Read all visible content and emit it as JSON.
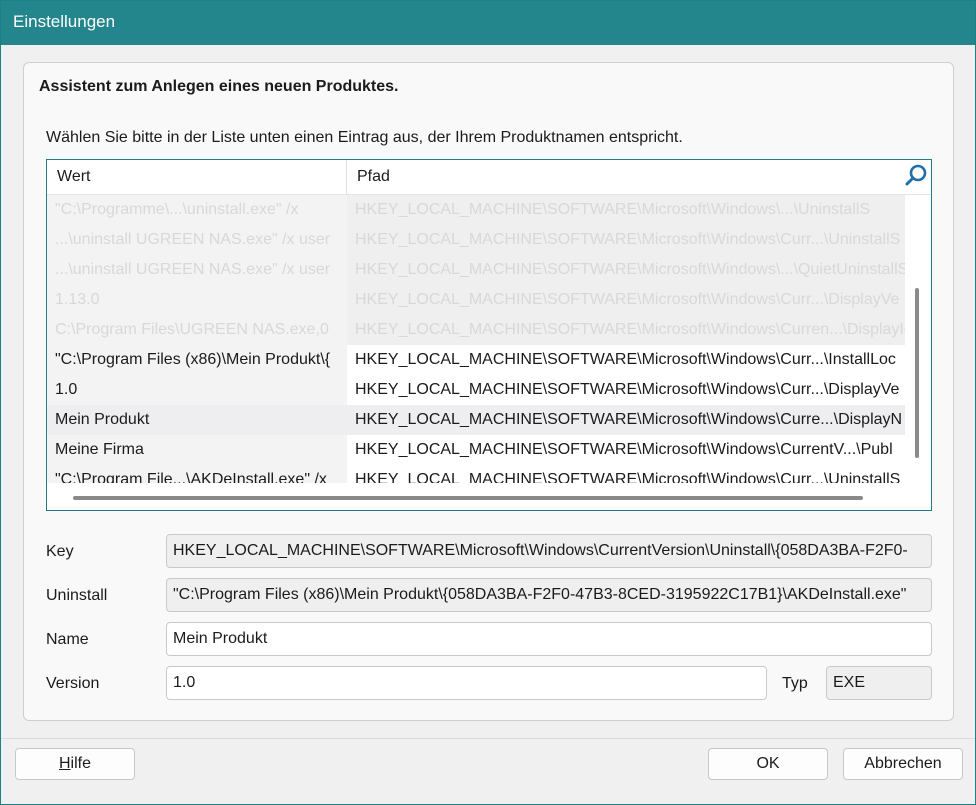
{
  "window": {
    "title": "Einstellungen"
  },
  "wizard": {
    "heading": "Assistent zum Anlegen eines neuen Produktes.",
    "instruction": "Wählen Sie bitte in der Liste unten einen Eintrag aus, der Ihrem Produktnamen entspricht."
  },
  "list": {
    "columns": {
      "value": "Wert",
      "path": "Pfad"
    },
    "search_icon": "search-icon",
    "rows": [
      {
        "value": "\"C:\\Programme\\...\\uninstall.exe\" /x",
        "path": "HKEY_LOCAL_MACHINE\\SOFTWARE\\Microsoft\\Windows\\...\\UninstallS",
        "faded": true
      },
      {
        "value": "...\\uninstall UGREEN NAS.exe\" /x user",
        "path": "HKEY_LOCAL_MACHINE\\SOFTWARE\\Microsoft\\Windows\\Curr...\\UninstallS",
        "faded": true
      },
      {
        "value": "...\\uninstall UGREEN NAS.exe\" /x user",
        "path": "HKEY_LOCAL_MACHINE\\SOFTWARE\\Microsoft\\Windows\\...\\QuietUninstallS",
        "faded": true
      },
      {
        "value": "1.13.0",
        "path": "HKEY_LOCAL_MACHINE\\SOFTWARE\\Microsoft\\Windows\\Curr...\\DisplayVe",
        "faded": true
      },
      {
        "value": "C:\\Program Files\\UGREEN NAS.exe,0",
        "path": "HKEY_LOCAL_MACHINE\\SOFTWARE\\Microsoft\\Windows\\Curren...\\DisplayIcon",
        "faded": true
      },
      {
        "value": "\"C:\\Program Files (x86)\\Mein Produkt\\{",
        "path": "HKEY_LOCAL_MACHINE\\SOFTWARE\\Microsoft\\Windows\\Curr...\\InstallLoc",
        "faded": false
      },
      {
        "value": "1.0",
        "path": "HKEY_LOCAL_MACHINE\\SOFTWARE\\Microsoft\\Windows\\Curr...\\DisplayVe",
        "faded": false
      },
      {
        "value": "Mein Produkt",
        "path": "HKEY_LOCAL_MACHINE\\SOFTWARE\\Microsoft\\Windows\\Curre...\\DisplayN",
        "faded": false,
        "selected": true
      },
      {
        "value": "Meine Firma",
        "path": "HKEY_LOCAL_MACHINE\\SOFTWARE\\Microsoft\\Windows\\CurrentV...\\Publ",
        "faded": false
      },
      {
        "value": "\"C:\\Program File...\\AKDeInstall.exe\" /x",
        "path": "HKEY_LOCAL_MACHINE\\SOFTWARE\\Microsoft\\Windows\\Curr...\\UninstallS",
        "faded": false
      }
    ]
  },
  "form": {
    "key_label": "Key",
    "key_value": "HKEY_LOCAL_MACHINE\\SOFTWARE\\Microsoft\\Windows\\CurrentVersion\\Uninstall\\{058DA3BA-F2F0-",
    "uninstall_label": "Uninstall",
    "uninstall_value": "\"C:\\Program Files (x86)\\Mein Produkt\\{058DA3BA-F2F0-47B3-8CED-3195922C17B1}\\AKDeInstall.exe\"",
    "name_label": "Name",
    "name_value": "Mein Produkt",
    "version_label": "Version",
    "version_value": "1.0",
    "typ_label": "Typ",
    "typ_value": "EXE"
  },
  "buttons": {
    "help_accel": "H",
    "help_rest": "ilfe",
    "ok": "OK",
    "cancel": "Abbrechen"
  },
  "colors": {
    "titlebar": "#23868c",
    "list_border": "#1f7f86"
  }
}
